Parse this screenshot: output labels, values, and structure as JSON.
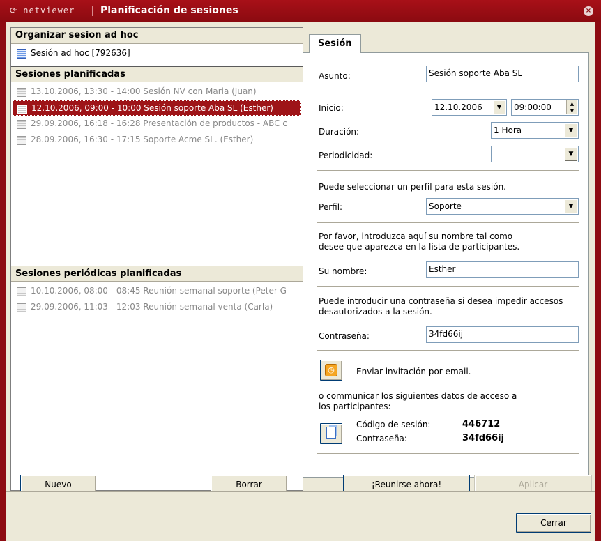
{
  "window": {
    "logo": "netviewer",
    "title": "Planificación de sesiones",
    "close": "×"
  },
  "left": {
    "adhoc_header": "Organizar sesion ad hoc",
    "adhoc_item": "Sesión ad hoc [792636]",
    "planned_header": "Sesiones planificadas",
    "planned_items": [
      "13.10.2006, 13:30 - 14:00 Sesión NV con Maria (Juan)",
      "12.10.2006, 09:00 - 10:00 Sesión soporte Aba SL (Esther)",
      "29.09.2006, 16:18 - 16:28 Presentación de productos - ABC c",
      "28.09.2006, 16:30 - 17:15 Soporte Acme SL. (Esther)"
    ],
    "periodic_header": "Sesiones periódicas planificadas",
    "periodic_items": [
      "10.10.2006, 08:00 - 08:45 Reunión semanal soporte (Peter G",
      "29.09.2006, 11:03 - 12:03 Reunión semanal venta (Carla)"
    ],
    "new_button": "Nuevo",
    "delete_button": "Borrar"
  },
  "form": {
    "tab": "Sesión",
    "subject_label": "Asunto:",
    "subject_value": "Sesión soporte Aba SL",
    "start_label": "Inicio:",
    "start_date": "12.10.2006",
    "start_time": "09:00:00",
    "duration_label": "Duración:",
    "duration_value": "1 Hora",
    "recurrence_label": "Periodicidad:",
    "recurrence_value": "",
    "profile_hint": "Puede seleccionar un perfil para esta sesión.",
    "profile_label_first": "P",
    "profile_label_rest": "erfil:",
    "profile_value": "Soporte",
    "name_hint_1": "Por favor, introduzca aquí su nombre tal como",
    "name_hint_2": "desee que aparezca en la lista de participantes.",
    "name_label": "Su nombre:",
    "name_value": "Esther",
    "password_hint_1": "Puede introducir una contraseña si desea impedir accesos",
    "password_hint_2": "desautorizados a la sesión.",
    "password_label": "Contraseña:",
    "password_value": "34fd66ij",
    "invite_label": "Enviar invitación por email.",
    "communicate_1": "o communicar los siguientes datos de acceso a",
    "communicate_2": "los participantes:",
    "code_label": "Código de sesión:",
    "code_value": "446712",
    "pw2_label": "Contraseña:",
    "pw2_value": "34fd66ij"
  },
  "actions": {
    "meet_now": "¡Reunirse ahora!",
    "apply": "Aplicar",
    "close": "Cerrar"
  },
  "colors": {
    "brand": "#9e1418",
    "dialog_bg": "#ece9d8"
  }
}
